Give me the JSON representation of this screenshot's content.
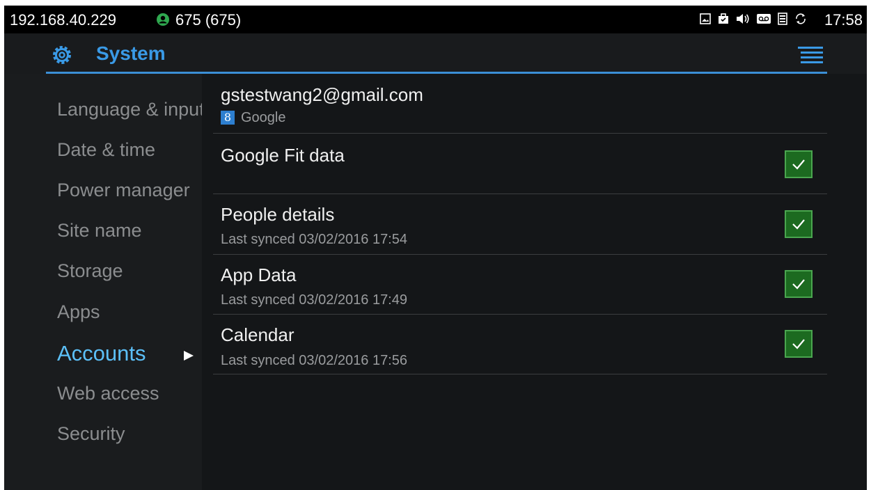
{
  "statusbar": {
    "ip": "192.168.40.229",
    "extension": "675 (675)",
    "time": "17:58",
    "icons": [
      "screenshot-icon",
      "bag-icon",
      "volume-icon",
      "voicemail-icon",
      "battery-icon",
      "sync-icon"
    ]
  },
  "header": {
    "title": "System",
    "title_icon": "gear-icon",
    "menu_icon": "menu-icon",
    "accent_color": "#3a9ae6"
  },
  "nav": {
    "items": [
      {
        "label": "Language & input"
      },
      {
        "label": "Date & time"
      },
      {
        "label": "Power manager"
      },
      {
        "label": "Site name"
      },
      {
        "label": "Storage"
      },
      {
        "label": "Apps"
      },
      {
        "label": "Accounts",
        "active": true
      },
      {
        "label": "Web access"
      },
      {
        "label": "Security"
      }
    ]
  },
  "account": {
    "email": "gstestwang2@gmail.com",
    "provider_badge": "8",
    "provider": "Google"
  },
  "sync_items": [
    {
      "title": "Google Fit data",
      "subtitle": "",
      "checked": true
    },
    {
      "title": "People details",
      "subtitle": "Last synced 03/02/2016 17:54",
      "checked": true
    },
    {
      "title": "App Data",
      "subtitle": "Last synced 03/02/2016 17:49",
      "checked": true
    },
    {
      "title": "Calendar",
      "subtitle": "Last synced 03/02/2016 17:56",
      "checked": true
    }
  ],
  "colors": {
    "checkbox_fill": "#1c6a20",
    "checkbox_border": "#4aa64f",
    "active_nav": "#5cc0f8"
  }
}
